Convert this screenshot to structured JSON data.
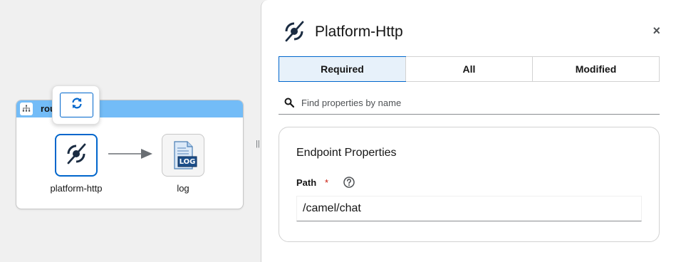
{
  "canvas": {
    "route": {
      "label": "rou"
    },
    "nodes": [
      {
        "label": "platform-http",
        "icon": "platform-http-icon"
      },
      {
        "label": "log",
        "icon": "log-icon",
        "badge": "LOG"
      }
    ],
    "toolbar": {
      "refresh_icon": "refresh-icon"
    }
  },
  "panel": {
    "title": "Platform-Http",
    "close_label": "×",
    "tabs": [
      {
        "label": "Required",
        "active": true
      },
      {
        "label": "All",
        "active": false
      },
      {
        "label": "Modified",
        "active": false
      }
    ],
    "search": {
      "placeholder": "Find properties by name",
      "value": ""
    },
    "section": {
      "title": "Endpoint Properties",
      "field": {
        "label": "Path",
        "required": "*",
        "value": "/camel/chat"
      }
    }
  },
  "colors": {
    "accent": "#0066cc",
    "route_header": "#73bcf7",
    "required": "#c9190b",
    "tab_active_bg": "#e7f1fa"
  }
}
